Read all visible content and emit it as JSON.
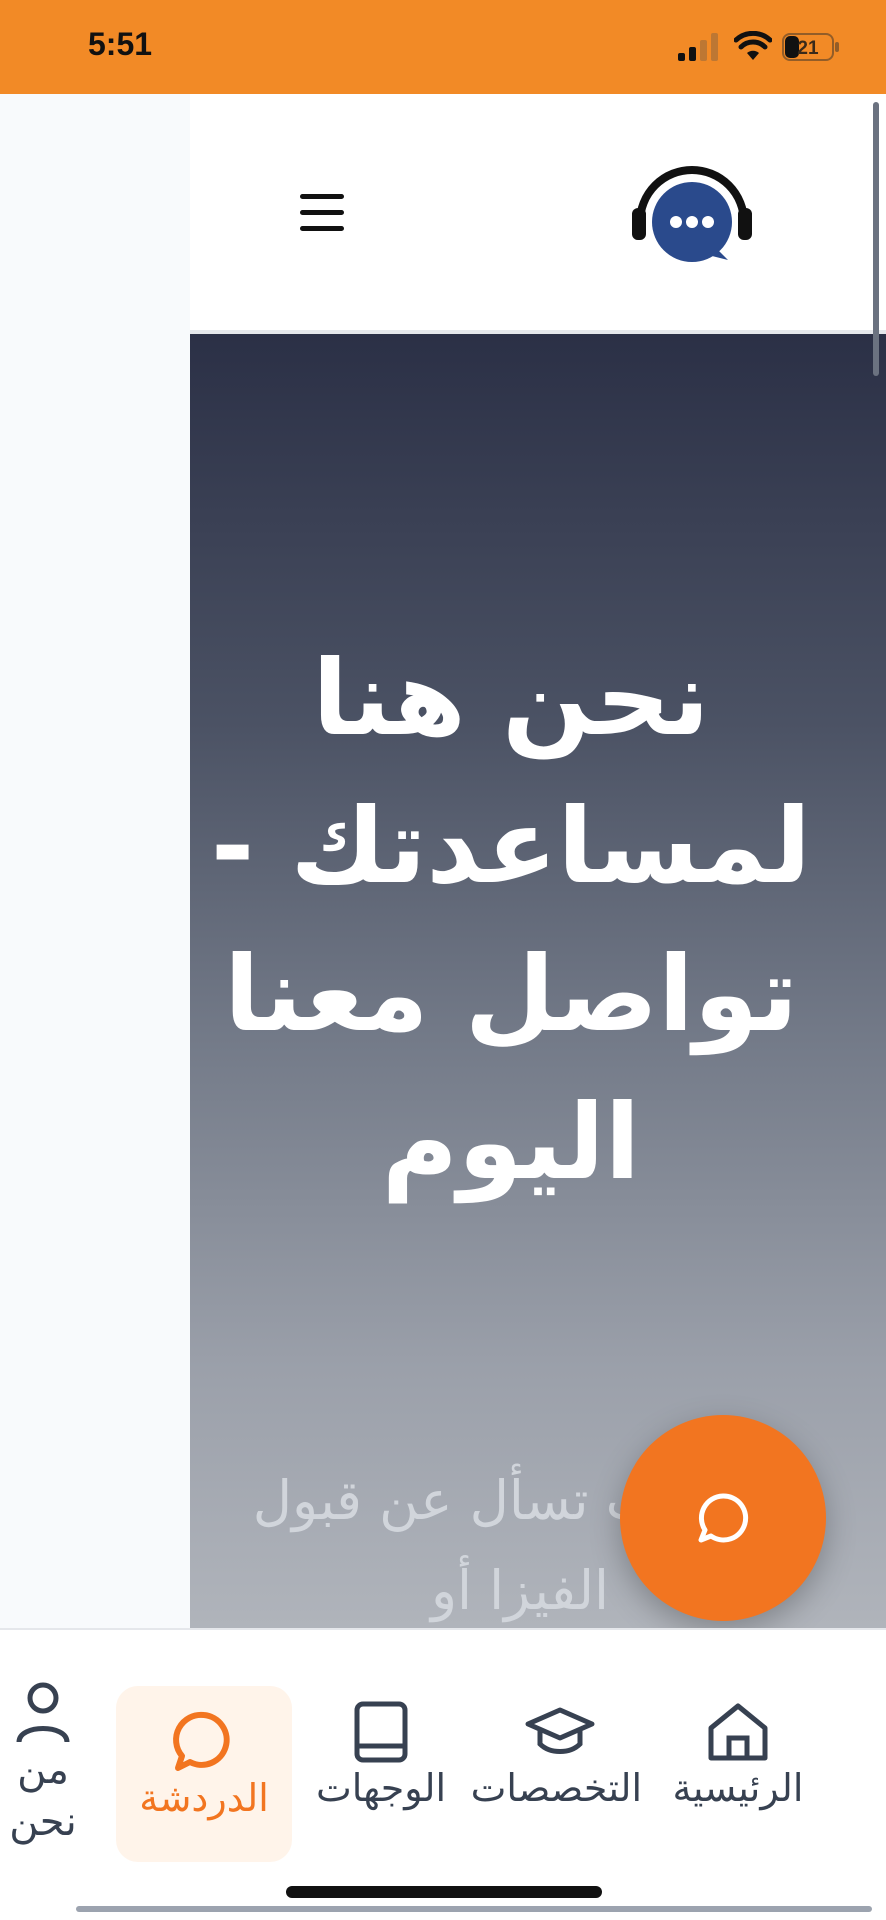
{
  "status_bar": {
    "time": "5:51",
    "battery_level": "21",
    "background_color": "#f28a26"
  },
  "header": {
    "logo_icon": "headset-chat-icon",
    "menu_icon": "hamburger-menu-icon"
  },
  "hero": {
    "title": "نحن هنا لمساعدتك - تواصل معنا اليوم",
    "subtitle": "هل كنت تسأل عن قبول الفيزا أو"
  },
  "chat_fab": {
    "icon": "chat-bubble-icon",
    "color": "#f27520"
  },
  "bottom_nav": {
    "items": [
      {
        "label": "الرئيسية",
        "icon": "home-icon",
        "active": false
      },
      {
        "label": "التخصصات",
        "icon": "graduation-cap-icon",
        "active": false
      },
      {
        "label": "الوجهات",
        "icon": "book-icon",
        "active": false
      },
      {
        "label": "الدردشة",
        "icon": "chat-bubble-icon",
        "active": true
      },
      {
        "label": "من نحن",
        "icon": "user-icon",
        "active": false
      }
    ],
    "active_color": "#f27520"
  }
}
